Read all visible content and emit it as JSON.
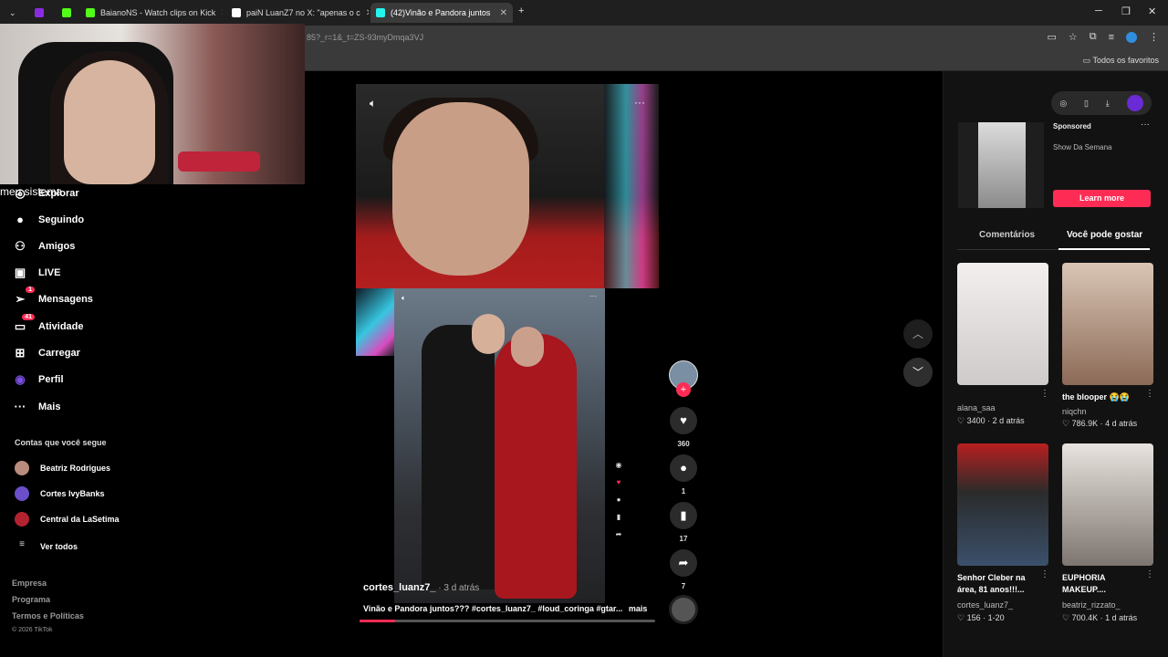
{
  "browser": {
    "tabs": [
      {
        "label": "",
        "color": "#8a2be2"
      },
      {
        "label": "",
        "color": "#53fc18"
      },
      {
        "label": "BaianoNS - Watch clips on Kick",
        "color": "#53fc18"
      },
      {
        "label": "paiN LuanZ7 no X: \"apenas o c",
        "color": "#ffffff"
      },
      {
        "label": "(42)Vinão e Pandora juntos",
        "color": "#25f4ee"
      }
    ],
    "url": "85?_r=1&_t=ZS-93myDmqa3VJ",
    "bookmarks_all": "Todos os favoritos"
  },
  "overlay_text": "meu sistema",
  "nav": {
    "items": [
      {
        "label": "Explorar",
        "icon": "compass-icon",
        "glyph": "◎"
      },
      {
        "label": "Seguindo",
        "icon": "following-icon",
        "glyph": "●"
      },
      {
        "label": "Amigos",
        "icon": "friends-icon",
        "glyph": "⚇"
      },
      {
        "label": "LIVE",
        "icon": "live-icon",
        "glyph": "▣"
      },
      {
        "label": "Mensagens",
        "icon": "messages-icon",
        "glyph": "➢",
        "badge": "1"
      },
      {
        "label": "Atividade",
        "icon": "activity-icon",
        "glyph": "▭",
        "badge": "41"
      },
      {
        "label": "Carregar",
        "icon": "upload-icon",
        "glyph": "⊞"
      },
      {
        "label": "Perfil",
        "icon": "profile-icon",
        "glyph": "◉"
      },
      {
        "label": "Mais",
        "icon": "more-icon",
        "glyph": "···"
      }
    ],
    "following_title": "Contas que você segue",
    "accounts": [
      {
        "name": "Beatriz Rodrigues",
        "color": "#b98c7c"
      },
      {
        "name": "Cortes IvyBanks",
        "color": "#6b4fc8"
      },
      {
        "name": "Central da LaSetima",
        "color": "#b2232f"
      }
    ],
    "see_all": "Ver todos",
    "footer": [
      "Empresa",
      "Programa",
      "Termos e Políticas",
      "© 2026 TikTok"
    ]
  },
  "video": {
    "username": "cortes_luanz7_",
    "time_ago": " · 3 d atrás",
    "caption": "Vinão e Pandora juntos??? #cortes_luanz7_ #loud_coringa #gtar...",
    "caption_more": "mais",
    "progress": 0.12,
    "likes": "360",
    "comments": "1",
    "saves": "17",
    "shares": "7"
  },
  "right_panel": {
    "ad_label": "Sponsored",
    "ad_name": "Show Da Semana",
    "ad_button": "Learn more",
    "tab_comments": "Comentários",
    "tab_suggestions": "Você pode gostar",
    "cards": [
      {
        "title": "",
        "user": "alana_saa",
        "likes": "♡ 3400",
        "date": "2 d atrás"
      },
      {
        "title": "the blooper 😭😭",
        "user": "niqchn",
        "likes": "♡ 786.9K",
        "date": "4 d atrás"
      },
      {
        "title": "Senhor Cleber na área, 81 anos!!!...",
        "user": "cortes_luanz7_",
        "likes": "♡ 156",
        "date": "1-20"
      },
      {
        "title": "EUPHORIA MAKEUP....",
        "user": "beatriz_rizzato_",
        "likes": "♡ 700.4K",
        "date": "1 d atrás"
      }
    ]
  },
  "colors": {
    "accent": "#fe2c55",
    "background": "#000000"
  }
}
